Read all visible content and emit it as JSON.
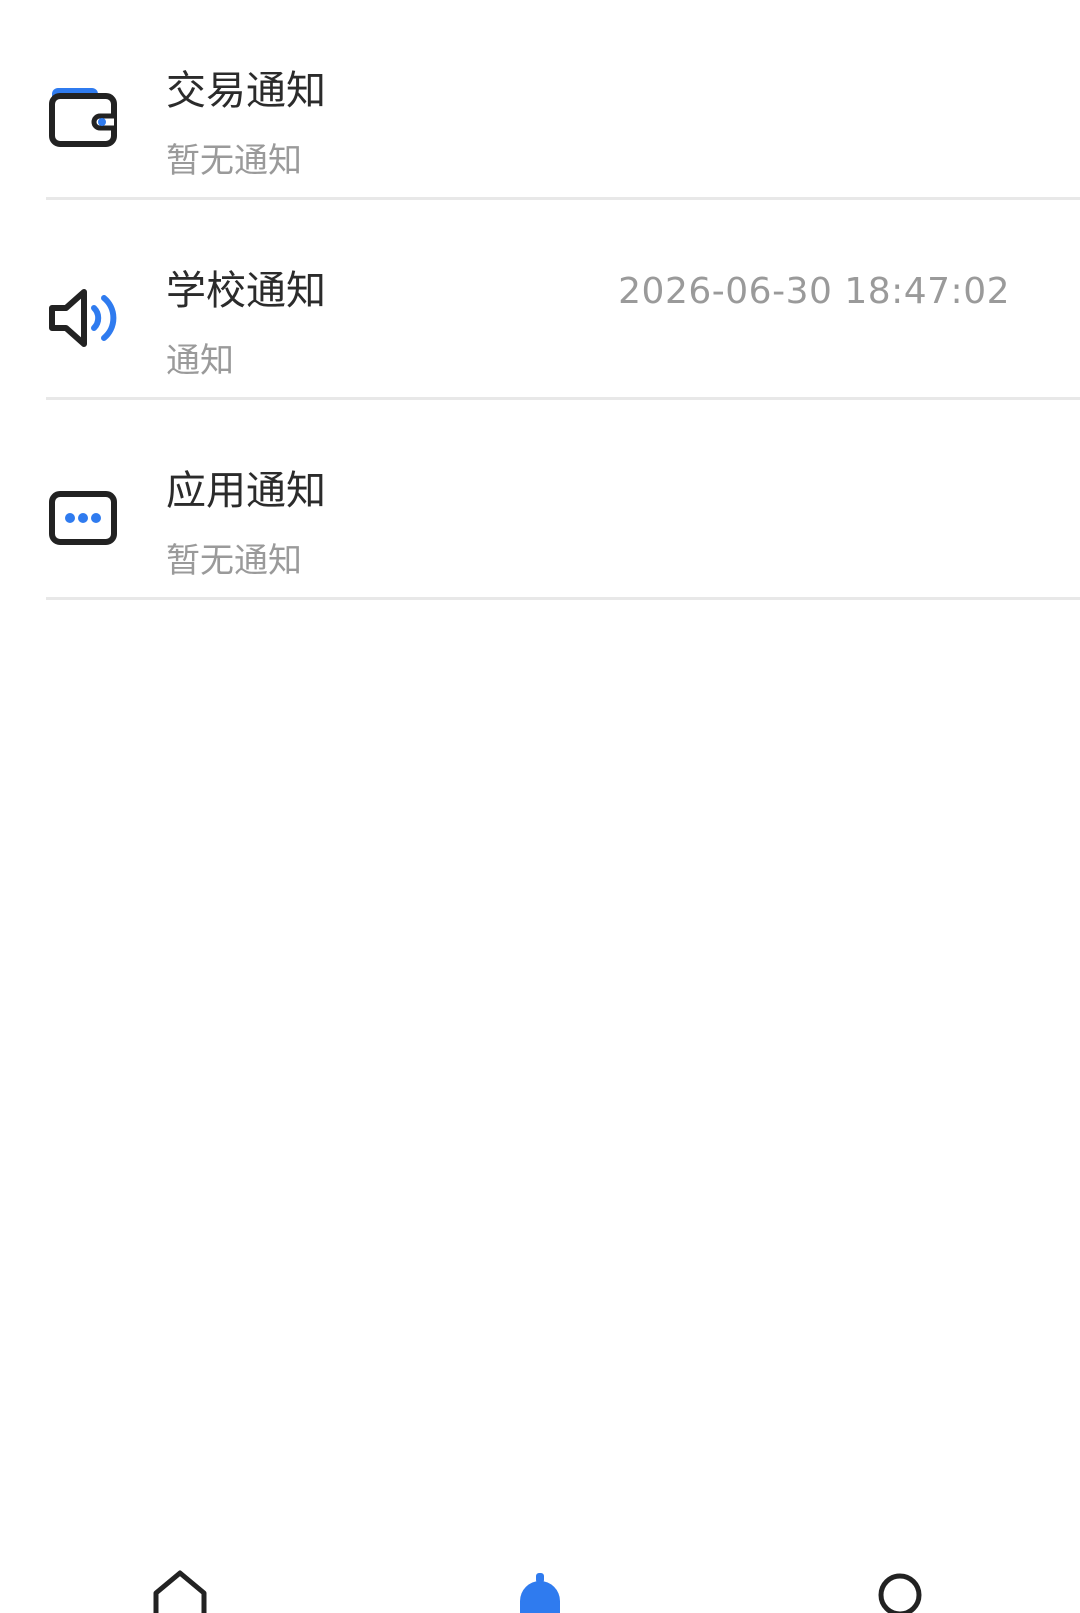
{
  "notifications": [
    {
      "icon": "wallet-icon",
      "title": "交易通知",
      "subtitle": "暂无通知",
      "time": ""
    },
    {
      "icon": "speaker-icon",
      "title": "学校通知",
      "subtitle": "通知",
      "time": "2026-06-30 18:47:02"
    },
    {
      "icon": "chat-dots-icon",
      "title": "应用通知",
      "subtitle": "暂无通知",
      "time": ""
    }
  ],
  "bottom_nav": {
    "items": [
      {
        "icon": "home-icon",
        "active": false
      },
      {
        "icon": "bell-icon",
        "active": true
      },
      {
        "icon": "profile-icon",
        "active": false
      }
    ]
  },
  "colors": {
    "accent": "#2f7bef",
    "icon_dark": "#222222",
    "title": "#2b2b2b",
    "secondary": "#9a9a9a",
    "divider": "#e8e8e8"
  }
}
